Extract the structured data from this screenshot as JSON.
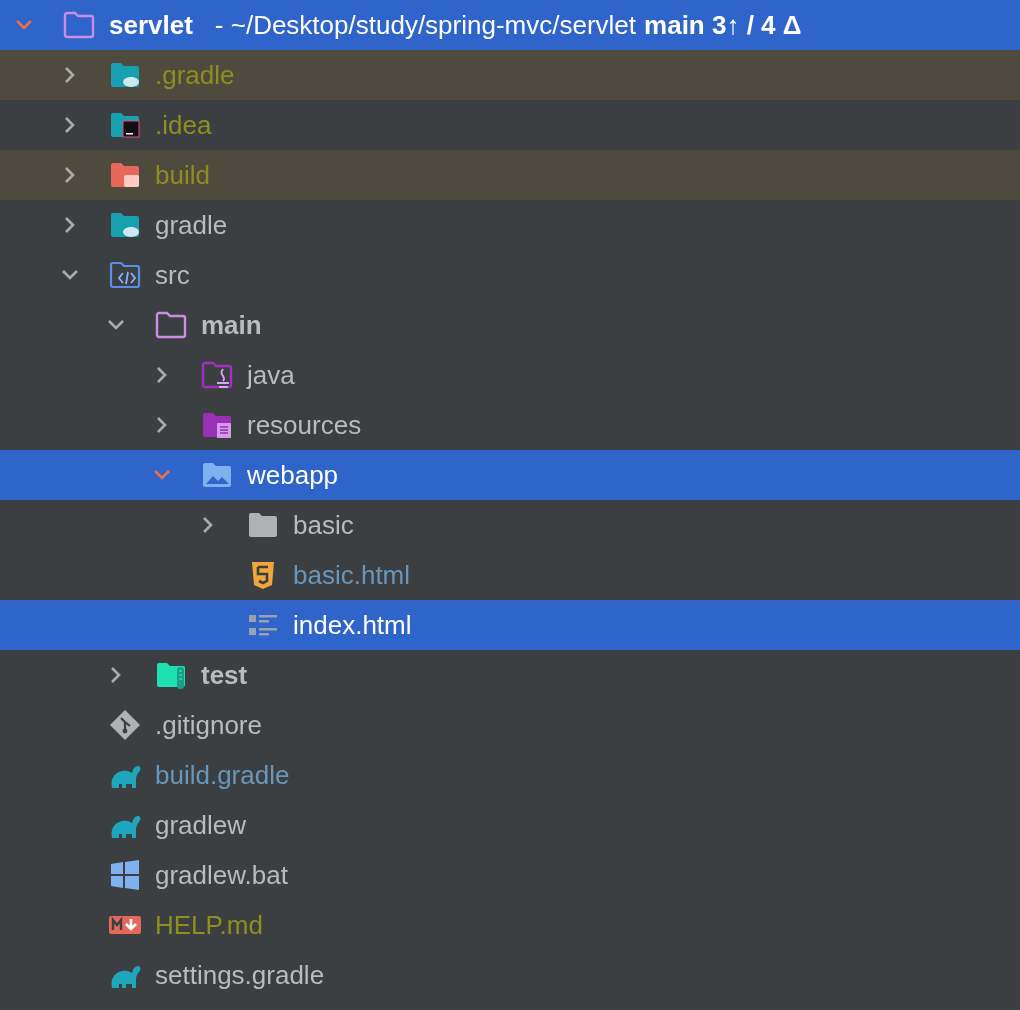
{
  "tree": {
    "root": {
      "name": "servlet",
      "path": "- ~/Desktop/study/spring-mvc/servlet",
      "branch": "main 3↑ / 4 Δ",
      "kind": "module",
      "expanded": true,
      "selected": true
    },
    "items": [
      {
        "name": ".gradle",
        "kind": "gradlefolder",
        "color": "#8f8f1f",
        "excluded": true,
        "selected": false,
        "expanded": false
      },
      {
        "name": ".idea",
        "kind": "ideafolder",
        "color": "#8f8f1f",
        "excluded": false,
        "selected": false,
        "expanded": false
      },
      {
        "name": "build",
        "kind": "buildfolder",
        "color": "#8f8f1f",
        "excluded": true,
        "selected": false,
        "expanded": false
      },
      {
        "name": "gradle",
        "kind": "gradlefolder",
        "color": "#bbbbbb",
        "excluded": false,
        "selected": false,
        "expanded": false
      },
      {
        "name": "src",
        "kind": "sourcefolder",
        "color": "#bbbbbb",
        "excluded": false,
        "selected": false,
        "expanded": true,
        "children": [
          {
            "name": "main",
            "kind": "module",
            "bold": true,
            "color": "#bbbbbb",
            "excluded": false,
            "selected": false,
            "expanded": true,
            "children": [
              {
                "name": "java",
                "kind": "javaroot",
                "color": "#bbbbbb",
                "excluded": false,
                "selected": false,
                "expanded": false
              },
              {
                "name": "resources",
                "kind": "resroot",
                "color": "#bbbbbb",
                "excluded": false,
                "selected": false,
                "expanded": false
              },
              {
                "name": "webapp",
                "kind": "webroot",
                "color": "#ffffff",
                "excluded": false,
                "selected": true,
                "expanded": true,
                "children": [
                  {
                    "name": "basic",
                    "kind": "folder",
                    "color": "#bbbbbb",
                    "excluded": false,
                    "selected": false,
                    "expanded": false
                  },
                  {
                    "name": "basic.html",
                    "kind": "html5",
                    "color": "#6897bb",
                    "excluded": false,
                    "selected": false
                  },
                  {
                    "name": "index.html",
                    "kind": "indexfile",
                    "color": "#ffffff",
                    "excluded": false,
                    "selected": true
                  }
                ]
              }
            ]
          },
          {
            "name": "test",
            "kind": "testroot",
            "bold": true,
            "color": "#bbbbbb",
            "excluded": false,
            "selected": false,
            "expanded": false
          }
        ]
      },
      {
        "name": ".gitignore",
        "kind": "gitfile",
        "color": "#bbbbbb",
        "excluded": false,
        "selected": false
      },
      {
        "name": "build.gradle",
        "kind": "gradlefile",
        "color": "#6897bb",
        "excluded": false,
        "selected": false
      },
      {
        "name": "gradlew",
        "kind": "gradlefile",
        "color": "#bbbbbb",
        "excluded": false,
        "selected": false
      },
      {
        "name": "gradlew.bat",
        "kind": "batfile",
        "color": "#bbbbbb",
        "excluded": false,
        "selected": false
      },
      {
        "name": "HELP.md",
        "kind": "markdown",
        "color": "#8f8f1f",
        "excluded": false,
        "selected": false
      },
      {
        "name": "settings.gradle",
        "kind": "gradlefile",
        "color": "#bbbbbb",
        "excluded": false,
        "selected": false
      }
    ]
  }
}
